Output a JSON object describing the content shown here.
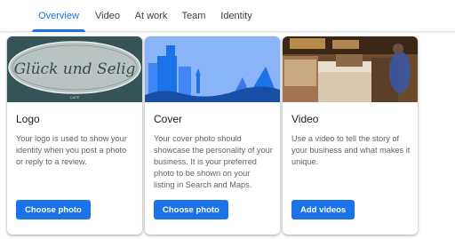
{
  "tabs": [
    {
      "label": "Overview",
      "active": true
    },
    {
      "label": "Video",
      "active": false
    },
    {
      "label": "At work",
      "active": false
    },
    {
      "label": "Team",
      "active": false
    },
    {
      "label": "Identity",
      "active": false
    }
  ],
  "accent_color": "#1a73e8",
  "cards": [
    {
      "title": "Logo",
      "description": "Your logo is used to show your identity when you post a photo or reply to a review.",
      "button_label": "Choose photo",
      "image": {
        "type": "logo",
        "logo_text": "Glück und Selig",
        "logo_subtext": "CAFÉ"
      }
    },
    {
      "title": "Cover",
      "description": "Your cover photo should showcase the personality of your business. It is your preferred photo to be shown on your listing in Search and Maps.",
      "button_label": "Choose photo",
      "image": {
        "type": "cover-illustration"
      }
    },
    {
      "title": "Video",
      "description": "Use a video to tell the story of your business and what makes it unique.",
      "button_label": "Add videos",
      "image": {
        "type": "cafe-photo"
      }
    }
  ]
}
